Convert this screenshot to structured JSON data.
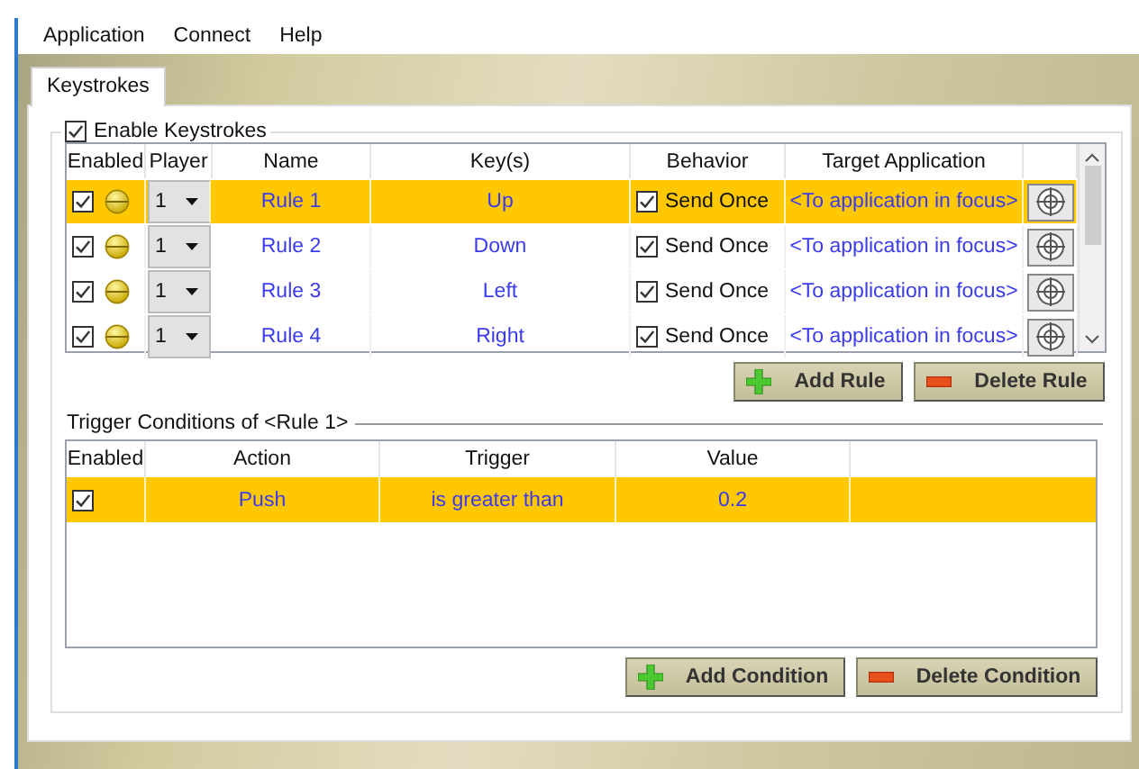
{
  "menu": [
    "Application",
    "Connect",
    "Help"
  ],
  "tabs": [
    {
      "label": "Keystrokes",
      "selected": true
    }
  ],
  "enable_keystrokes": {
    "label": "Enable Keystrokes",
    "checked": true
  },
  "rules_table": {
    "columns": [
      "Enabled",
      "Player",
      "Name",
      "Key(s)",
      "Behavior",
      "Target Application"
    ],
    "rows": [
      {
        "enabled": true,
        "player": "1",
        "name": "Rule 1",
        "keys": "Up",
        "send_once": true,
        "behavior": "Send Once",
        "target": "<To application in focus>",
        "selected": true
      },
      {
        "enabled": true,
        "player": "1",
        "name": "Rule 2",
        "keys": "Down",
        "send_once": true,
        "behavior": "Send Once",
        "target": "<To application in focus>",
        "selected": false
      },
      {
        "enabled": true,
        "player": "1",
        "name": "Rule 3",
        "keys": "Left",
        "send_once": true,
        "behavior": "Send Once",
        "target": "<To application in focus>",
        "selected": false
      },
      {
        "enabled": true,
        "player": "1",
        "name": "Rule 4",
        "keys": "Right",
        "send_once": true,
        "behavior": "Send Once",
        "target": "<To application in focus>",
        "selected": false
      }
    ]
  },
  "rule_buttons": [
    {
      "kind": "add",
      "label": "Add Rule"
    },
    {
      "kind": "delete",
      "label": "Delete Rule"
    }
  ],
  "conditions_group": {
    "title": "Trigger Conditions of <Rule 1>"
  },
  "conditions_table": {
    "columns": [
      "Enabled",
      "Action",
      "Trigger",
      "Value"
    ],
    "rows": [
      {
        "enabled": true,
        "action": "Push",
        "trigger": "is greater than",
        "value": "0.2",
        "selected": true
      }
    ]
  },
  "condition_buttons": [
    {
      "kind": "add",
      "label": "Add Condition"
    },
    {
      "kind": "delete",
      "label": "Delete Condition"
    }
  ]
}
